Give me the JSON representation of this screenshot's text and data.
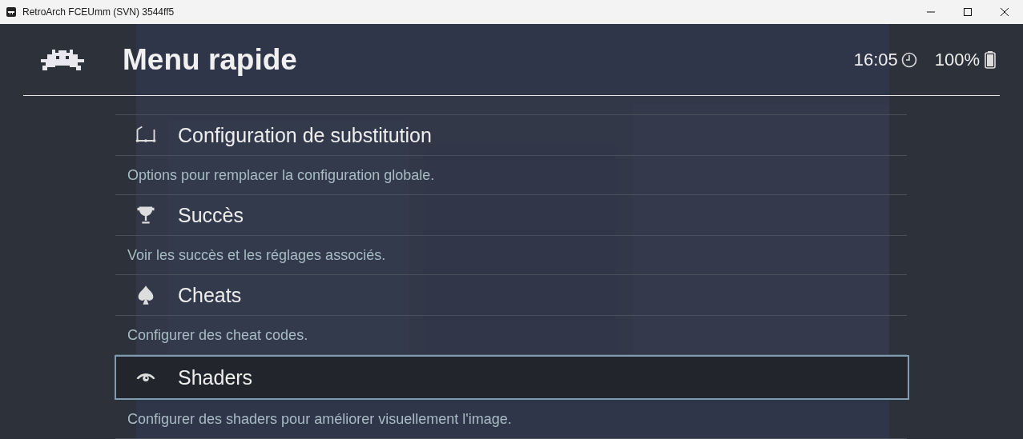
{
  "window": {
    "title": "RetroArch FCEUmm (SVN) 3544ff5"
  },
  "header": {
    "title": "Menu rapide",
    "clock": "16:05",
    "battery": "100%"
  },
  "entries": [
    {
      "title": "Configuration de substitution",
      "description": "Options pour remplacer la configuration globale.",
      "selected": false
    },
    {
      "title": "Succès",
      "description": "Voir les succès et les réglages associés.",
      "selected": false
    },
    {
      "title": "Cheats",
      "description": "Configurer des cheat codes.",
      "selected": false
    },
    {
      "title": "Shaders",
      "description": "Configurer des shaders pour améliorer visuellement l'image.",
      "selected": true
    }
  ]
}
